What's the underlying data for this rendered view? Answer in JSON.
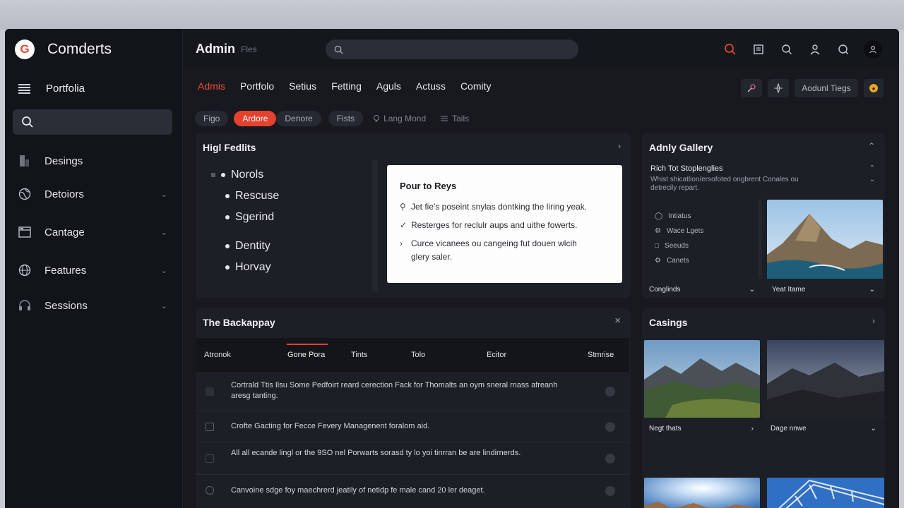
{
  "brand": {
    "name": "Comderts",
    "logo_letter": "G"
  },
  "sidebar": {
    "portfolio": "Portfolia",
    "search_placeholder": "",
    "items": [
      {
        "label": "Desings",
        "icon": "bookmark-icon",
        "has_chevron": false
      },
      {
        "label": "Detoiors",
        "icon": "globe-icon",
        "has_chevron": true
      },
      {
        "label": "Cantage",
        "icon": "window-icon",
        "has_chevron": true
      },
      {
        "label": "Features",
        "icon": "globe-icon",
        "has_chevron": true
      },
      {
        "label": "Sessions",
        "icon": "headset-icon",
        "has_chevron": true
      }
    ]
  },
  "topbar": {
    "title": "Admin",
    "subtitle": "Fles",
    "search_placeholder": ""
  },
  "tabs": [
    "Admis",
    "Portfolo",
    "Setius",
    "Fetting",
    "Aguls",
    "Actuss",
    "Comity"
  ],
  "nav_right": {
    "button_label": "Aodunl Tiegs"
  },
  "chips": [
    "Figo",
    "Ardore",
    "Denore",
    "Fists",
    "Lang Mond",
    "Tails"
  ],
  "high_feats": {
    "title": "Higl Fedlits",
    "list": [
      "Norols",
      "Rescuse",
      "Sgerind",
      "Dentity",
      "Horvay"
    ],
    "card": {
      "title": "Pour to Reys",
      "lines": [
        "Jet fie's poseint snylas dontking the liring yeak.",
        "Resterges for reclulr aups and uithe fowerts.",
        "Curce vicanees ou cangeing fut douen wlcih",
        "glery saler."
      ]
    }
  },
  "gallery": {
    "title": "Adnly Gallery",
    "sub_title": "Rich Tot Stoplenglies",
    "sub_text": "Whist shicatlion/ersofoted ongbrent Conales ou detrecily repart.",
    "list": [
      "Intiatus",
      "Wace Lgets",
      "Seeuds",
      "Canets"
    ],
    "foot_left": "Conglinds",
    "foot_right": "Yeat Itame"
  },
  "backlog": {
    "title": "The Backappay",
    "columns": [
      "Atronok",
      "Gone Pora",
      "Tints",
      "Tolo",
      "Ecitor",
      "Stmrise"
    ],
    "rows": [
      "Cortrald Ttis Ilsu Some Pedfoirt reard cerection Fack for Thomalts an oym sneral rnass afreanh aresg tanting.",
      "Crofte Gacting for Fecce Fevery Managenent foralom aid.",
      "All all ecande lingl or the 9SO nel Porwarts sorasd ty lo yoi tinrran be are lindirnerds.",
      "Canvoine sdge foy maechrerd jeatily of netidp fe male cand 20 ler deaget."
    ]
  },
  "casings": {
    "title": "Casings",
    "captions": [
      "Negt thats",
      "Dage nnwe"
    ]
  },
  "colors": {
    "accent": "#e5412f",
    "bg": "#15181e"
  }
}
